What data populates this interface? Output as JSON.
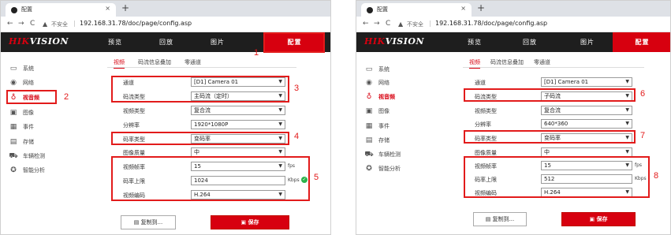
{
  "browser": {
    "tab_title": "配置",
    "tab_close": "×",
    "new_tab": "+",
    "back": "←",
    "forward": "→",
    "reload": "C",
    "warn": "▲",
    "insecure_label": "不安全",
    "separator": "|",
    "url": "192.168.31.78/doc/page/config.asp"
  },
  "app": {
    "logo_hik": "HIK",
    "logo_vision": "VISION",
    "menu": [
      "预览",
      "回放",
      "图片",
      "配置"
    ],
    "active_menu_index": 3
  },
  "left": {
    "sidebar": [
      {
        "icon": "▭",
        "label": "系统"
      },
      {
        "icon": "◉",
        "label": "网络"
      },
      {
        "icon": "♁",
        "label": "视音频"
      },
      {
        "icon": "▣",
        "label": "图像"
      },
      {
        "icon": "▦",
        "label": "事件"
      },
      {
        "icon": "▤",
        "label": "存储"
      },
      {
        "icon": "⛟",
        "label": "车辆检测"
      },
      {
        "icon": "✪",
        "label": "智能分析"
      }
    ],
    "subtabs": [
      "视频",
      "码流信息叠加",
      "零通道"
    ],
    "fields": {
      "channel_label": "通道",
      "channel_value": "[D1] Camera 01",
      "stream_type_label": "码流类型",
      "stream_type_value": "主码流（定时）",
      "video_type_label": "视频类型",
      "video_type_value": "复合流",
      "resolution_label": "分辨率",
      "resolution_value": "1920*1080P",
      "bitrate_type_label": "码率类型",
      "bitrate_type_value": "变码率",
      "quality_label": "图像质量",
      "quality_value": "中",
      "fps_label": "视频帧率",
      "fps_value": "15",
      "fps_unit": "fps",
      "maxrate_label": "码率上限",
      "maxrate_value": "1024",
      "maxrate_unit": "Kbps",
      "encoding_label": "视频编码",
      "encoding_value": "H.264"
    },
    "copy_button": "复制到...",
    "save_button": "保存",
    "callouts": [
      "1",
      "2",
      "3",
      "4",
      "5"
    ]
  },
  "right": {
    "sidebar": [
      {
        "icon": "▭",
        "label": "系统"
      },
      {
        "icon": "◉",
        "label": "网络"
      },
      {
        "icon": "♁",
        "label": "视音频"
      },
      {
        "icon": "▣",
        "label": "图像"
      },
      {
        "icon": "▦",
        "label": "事件"
      },
      {
        "icon": "▤",
        "label": "存储"
      },
      {
        "icon": "⛟",
        "label": "车辆检测"
      },
      {
        "icon": "✪",
        "label": "智能分析"
      }
    ],
    "subtabs": [
      "视频",
      "码流信息叠加",
      "零通道"
    ],
    "fields": {
      "channel_label": "通道",
      "channel_value": "[D1] Camera 01",
      "stream_type_label": "码流类型",
      "stream_type_value": "子码流",
      "video_type_label": "视频类型",
      "video_type_value": "复合流",
      "resolution_label": "分辨率",
      "resolution_value": "640*360",
      "bitrate_type_label": "码率类型",
      "bitrate_type_value": "变码率",
      "quality_label": "图像质量",
      "quality_value": "中",
      "fps_label": "视频帧率",
      "fps_value": "15",
      "fps_unit": "fps",
      "maxrate_label": "码率上限",
      "maxrate_value": "512",
      "maxrate_unit": "Kbps",
      "encoding_label": "视频编码",
      "encoding_value": "H.264"
    },
    "copy_button": "复制到...",
    "save_button": "保存",
    "callouts": [
      "6",
      "7",
      "8"
    ]
  },
  "colors": {
    "brand_red": "#d7000f",
    "header_bg": "#1e1e1e",
    "callout_red": "#e21b1b"
  }
}
